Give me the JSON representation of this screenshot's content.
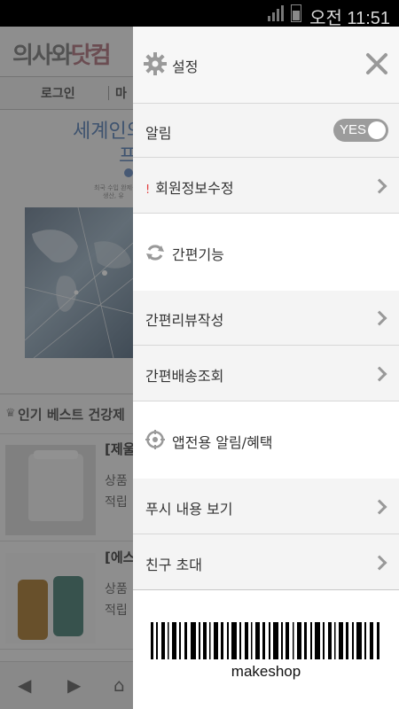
{
  "status_bar": {
    "time": "오전 11:51"
  },
  "background_page": {
    "logo_part1": "의사와",
    "logo_part2": "닷컴",
    "nav_login": "로그인",
    "nav_my": "마",
    "hero_title": "세계인의",
    "hero_sub": "프",
    "hero_small_1": "최국 수입 완제품",
    "hero_small_2": "생산, 유",
    "best_title": "인기 베스트 건강제",
    "products": [
      {
        "title": "[제울",
        "line1": "상품",
        "line2": "적립"
      },
      {
        "title": "[에스",
        "line1": "상품",
        "line2": "적립"
      }
    ]
  },
  "drawer": {
    "header_title": "설정",
    "notification_label": "알림",
    "notification_toggle": "YES",
    "notification_on": true,
    "member_edit_label": "회원정보수정",
    "section_quick": "간편기능",
    "review_label": "간편리뷰작성",
    "delivery_label": "간편배송조회",
    "section_app": "앱전용 알림/혜택",
    "push_label": "푸시 내용 보기",
    "invite_label": "친구 초대",
    "barcode_label": "makeshop"
  },
  "colors": {
    "toggle_bg": "#9c9c9c",
    "alert_red": "#e34040",
    "accent_blue": "#6c8fbf"
  }
}
